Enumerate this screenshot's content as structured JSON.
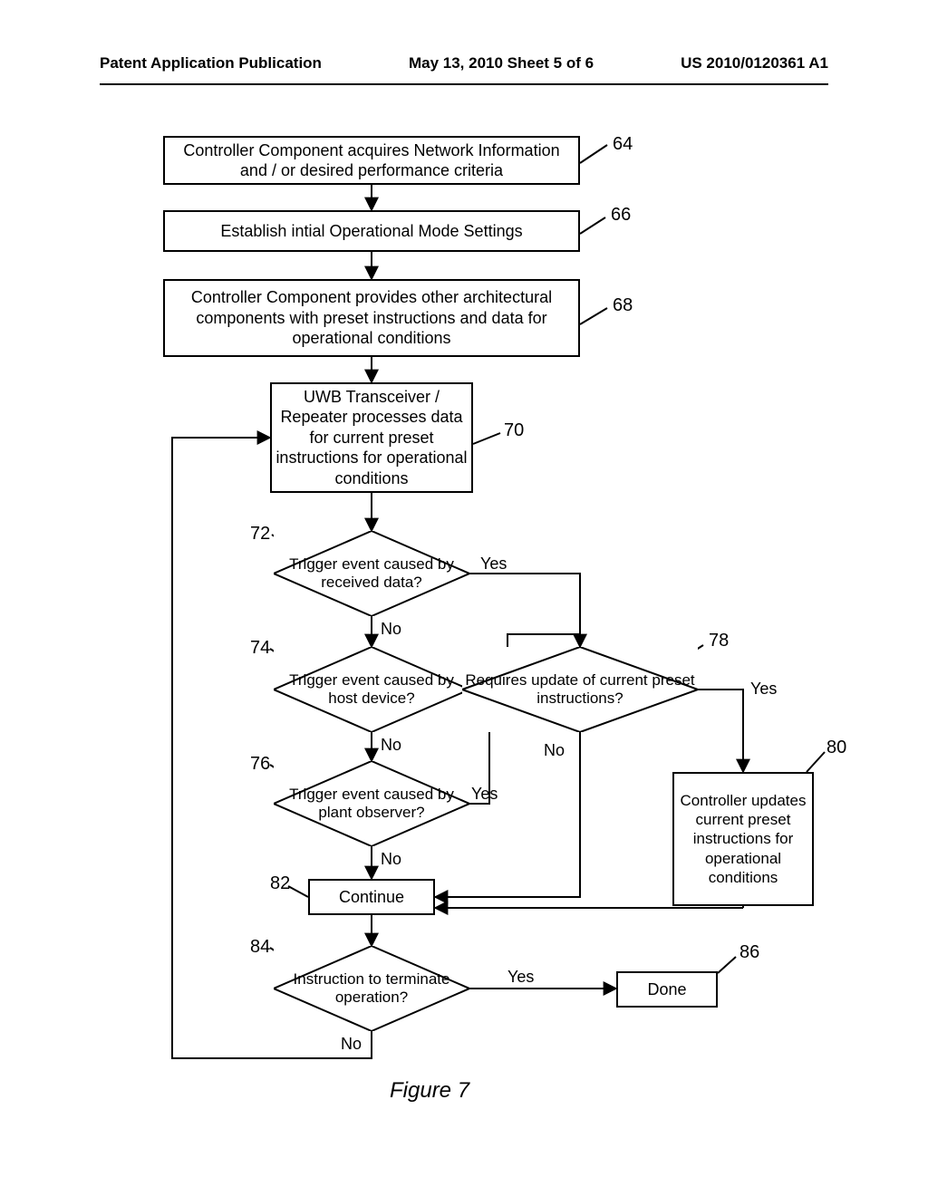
{
  "header": {
    "left": "Patent Application Publication",
    "center": "May 13, 2010  Sheet 5 of 6",
    "right": "US 2010/0120361 A1"
  },
  "nodes": {
    "n64": {
      "text": "Controller Component acquires Network Information and / or desired performance criteria",
      "ref": "64"
    },
    "n66": {
      "text": "Establish intial Operational Mode Settings",
      "ref": "66"
    },
    "n68": {
      "text": "Controller Component provides other architectural components with preset instructions and data for operational conditions",
      "ref": "68"
    },
    "n70": {
      "text": "UWB Transceiver / Repeater processes data for current preset instructions for operational conditions",
      "ref": "70"
    },
    "n72": {
      "text": "Trigger event caused by received data?",
      "ref": "72"
    },
    "n74": {
      "text": "Trigger event caused by host device?",
      "ref": "74"
    },
    "n76": {
      "text": "Trigger event caused by plant observer?",
      "ref": "76"
    },
    "n78": {
      "text": "Requires update of current preset instructions?",
      "ref": "78"
    },
    "n80": {
      "text": "Controller updates current preset instructions for operational conditions",
      "ref": "80"
    },
    "n82": {
      "text": "Continue",
      "ref": "82"
    },
    "n84": {
      "text": "Instruction to terminate operation?",
      "ref": "84"
    },
    "n86": {
      "text": "Done",
      "ref": "86"
    }
  },
  "edges": {
    "yes": "Yes",
    "no": "No"
  },
  "caption": "Figure 7"
}
